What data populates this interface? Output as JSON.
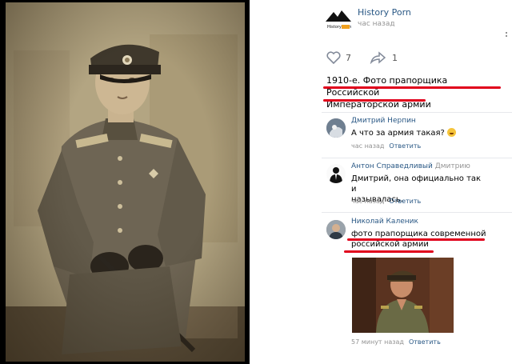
{
  "post": {
    "group_name": "History Porn",
    "logo_text": "History Porn",
    "time": "час назад",
    "likes": "7",
    "shares": "1",
    "text_line1": "1910-е. Фото прапорщика Российской",
    "text_line2": "Императорской армии"
  },
  "comments": [
    {
      "author": "Дмитрий Нерпин",
      "reply_to": "",
      "text": "А что за армия такая?",
      "time": "час назад",
      "reply": "Ответить"
    },
    {
      "author": "Антон Справедливый",
      "reply_to": "Дмитрию",
      "text_line1": "Дмитрий, она официально так и",
      "text_line2": "называлась.",
      "time": "час назад",
      "reply": "Ответить"
    },
    {
      "author": "Николай Каленик",
      "reply_to": "",
      "text_line1": "фото прапорщика современной",
      "text_line2": "российской армии",
      "time": "57 минут назад",
      "reply": "Ответить"
    }
  ],
  "colors": {
    "accent": "#2a5885",
    "highlight": "#e0001b",
    "meta": "#939393"
  },
  "icons": [
    "heart-icon",
    "share-arrow-icon",
    "more-dots-icon"
  ]
}
